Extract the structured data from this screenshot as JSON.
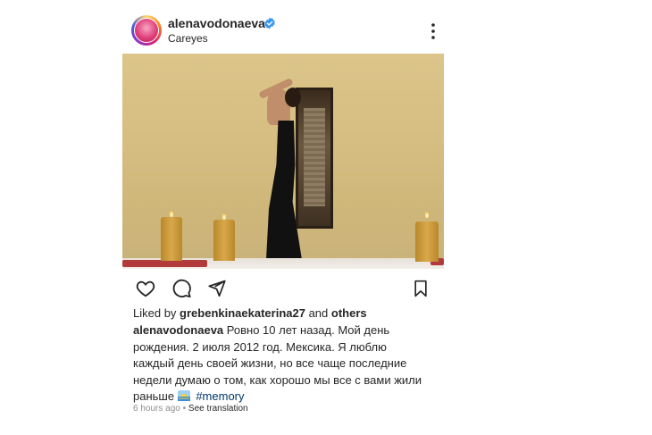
{
  "post": {
    "username": "alenavodonaeva",
    "location": "Careyes",
    "verified": true,
    "liked_by_prefix": "Liked by",
    "liked_by_user": "grebenkinaekaterina27",
    "liked_by_and": "and",
    "liked_by_others": "others",
    "caption_user": "alenavodonaeva",
    "caption_text": "Ровно 10 лет назад. Мой день рождения. 2 июля 2012 год. Мексика.  Я люблю каждый день своей жизни, но все чаще последние недели думаю о том, как хорошо мы все с вами жили раньше",
    "hashtag": "#memory",
    "time_ago": "6 hours ago",
    "separator": "•",
    "see_translation": "See translation"
  },
  "icons": {
    "like": "heart-icon",
    "comment": "comment-icon",
    "share": "paper-plane-icon",
    "save": "bookmark-icon",
    "more": "three-dots-vertical-icon",
    "emoji": "sunrise-emoji"
  },
  "colors": {
    "text": "#262626",
    "muted": "#8e8e8e",
    "link": "#00376b",
    "verified": "#3897f0"
  }
}
